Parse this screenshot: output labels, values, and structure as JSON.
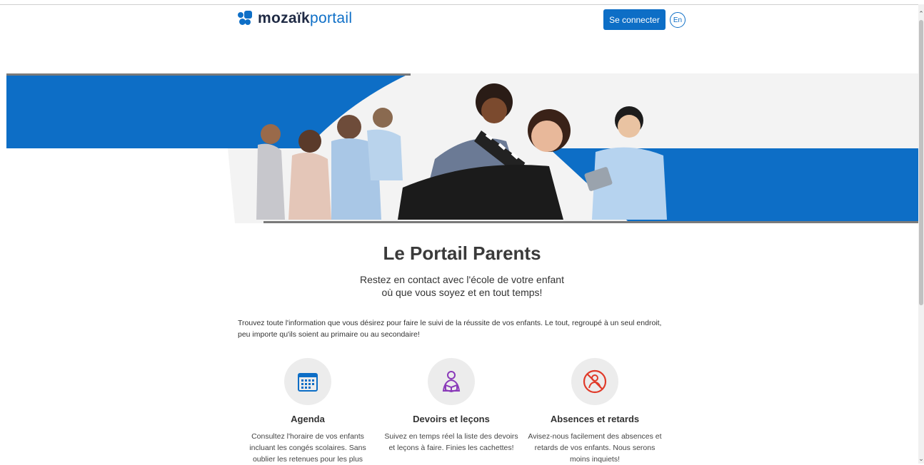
{
  "header": {
    "logo_strong": "mozaïk",
    "logo_light": "portail",
    "login_label": "Se connecter",
    "lang_label": "En"
  },
  "colors": {
    "brand_blue": "#0d6ec6",
    "hero_grey": "#f1f1f1",
    "dark_text": "#1f2a44",
    "icon_blue": "#0d6ec6",
    "icon_purple": "#8a3ab9",
    "icon_red": "#e03b2a"
  },
  "main": {
    "title": "Le Portail Parents",
    "tagline_line1": "Restez en contact avec l'école de votre enfant",
    "tagline_line2": "où que vous soyez et en tout temps!",
    "intro": "Trouvez toute l'information que vous désirez pour faire le suivi de la réussite de vos enfants. Le tout, regroupé à un seul endroit, peu importe qu'ils soient au primaire ou au secondaire!"
  },
  "features": [
    {
      "icon": "calendar-icon",
      "title": "Agenda",
      "desc": "Consultez l'horaire de vos enfants incluant les congés scolaires. Sans oublier les retenues pour les plus"
    },
    {
      "icon": "student-reading-icon",
      "title": "Devoirs et leçons",
      "desc": "Suivez en temps réel la liste des devoirs et leçons à faire. Finies les cachettes!"
    },
    {
      "icon": "absence-icon",
      "title": "Absences et retards",
      "desc": "Avisez-nous facilement des absences et retards de vos enfants. Nous serons moins inquiets!"
    }
  ]
}
